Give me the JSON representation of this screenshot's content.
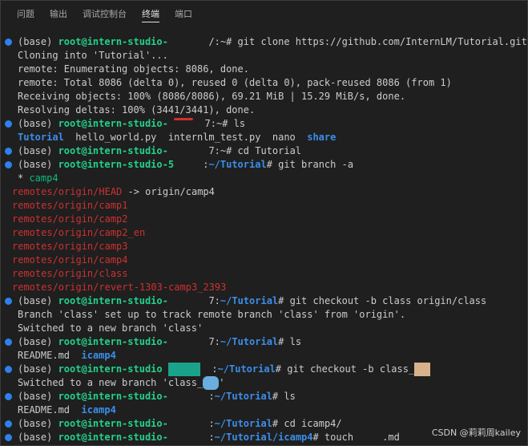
{
  "panel": {
    "tabs": [
      {
        "label": "问题"
      },
      {
        "label": "输出"
      },
      {
        "label": "调试控制台"
      },
      {
        "label": "终端"
      },
      {
        "label": "端口"
      }
    ]
  },
  "terminal": {
    "env": "(base) ",
    "host": "root@intern-studio-",
    "host_mid": "root@intern-studio",
    "host_5": "root@intern-studio-5",
    "l1_cmd": "/:~# git clone https://github.com/InternLM/Tutorial.git",
    "l2": "Cloning into 'Tutorial'...",
    "l3": "remote: Enumerating objects: 8086, done.",
    "l4": "remote: Total 8086 (delta 0), reused 0 (delta 0), pack-reused 8086 (from 1)",
    "l5": "Receiving objects: 100% (8086/8086), 69.21 MiB | 15.29 MiB/s, done.",
    "l6": "Resolving deltas: 100% (3441/3441), done.",
    "l7_cmd": "7:~# ls",
    "ls_tutorial": "Tutorial",
    "ls_files": "  hello_world.py  internlm_test.py  nano  ",
    "ls_share": "share",
    "l9_cmd": "7:~# cd Tutorial",
    "l10_path_sep": ":",
    "path_tutorial": "~/Tutorial",
    "l10_cmd": "# git branch -a",
    "branch_current_marker": "* ",
    "branch_current": "camp4",
    "remotes": [
      "remotes/origin/HEAD",
      "remotes/origin/camp1",
      "remotes/origin/camp2",
      "remotes/origin/camp2_en",
      "remotes/origin/camp3",
      "remotes/origin/camp4",
      "remotes/origin/class",
      "remotes/origin/revert-1303-camp3_2393"
    ],
    "head_arrow": " -> origin/camp4",
    "prefix_7": "7:",
    "prefix_colon": ":",
    "cmd_checkout_origin": "# git checkout -b class origin/class",
    "branch_setup": "Branch 'class' set up to track remote branch 'class' from 'origin'.",
    "switched_class": "Switched to a new branch 'class'",
    "cmd_ls": "# ls",
    "readme": "README.md  ",
    "icamp4": "icamp4",
    "cmd_checkout_new": "# git checkout -b class_",
    "switched_new_a": "Switched to a new branch 'class_",
    "switched_new_b": "'",
    "cmd_cd_icamp4": "# cd icamp4/",
    "path_icamp4": "~/Tutorial/icamp4",
    "cmd_touch": "# touch ",
    "touch_file": ".md"
  },
  "watermark": "CSDN @莉莉周kailey"
}
